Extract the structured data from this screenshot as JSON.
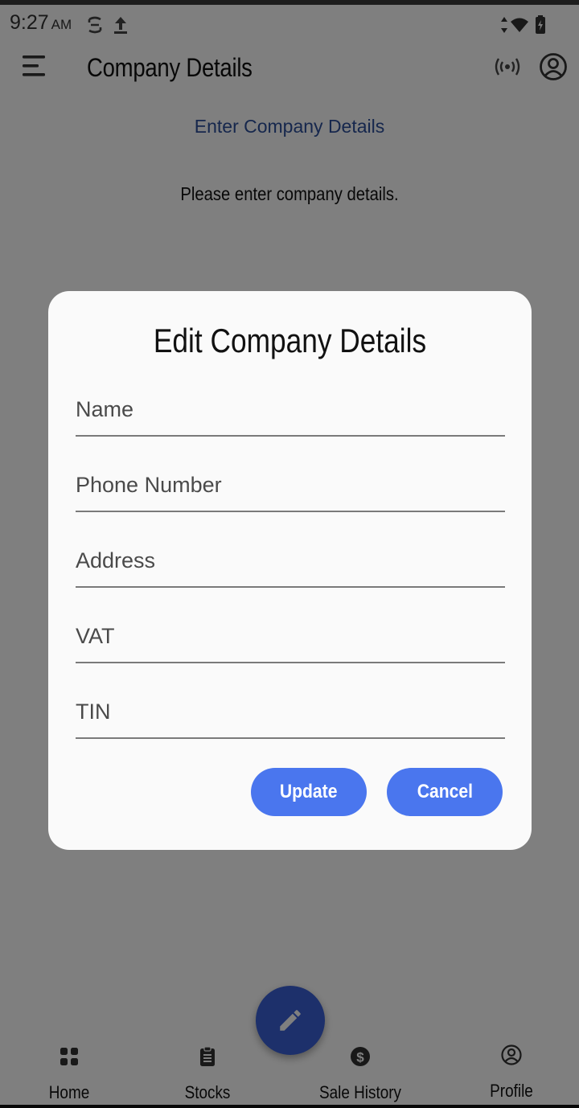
{
  "status_bar": {
    "time": "9:27",
    "ampm": "AM"
  },
  "app_bar": {
    "title": "Company Details",
    "icons": [
      "menu-icon",
      "radio-tower-icon",
      "account-circle-icon"
    ]
  },
  "page": {
    "heading": "Enter Company Details",
    "subtext": "Please enter company details."
  },
  "dialog": {
    "title": "Edit Company Details",
    "fields": [
      {
        "placeholder": "Name",
        "value": ""
      },
      {
        "placeholder": "Phone Number",
        "value": ""
      },
      {
        "placeholder": "Address",
        "value": ""
      },
      {
        "placeholder": "VAT",
        "value": ""
      },
      {
        "placeholder": "TIN",
        "value": ""
      }
    ],
    "update_label": "Update",
    "cancel_label": "Cancel"
  },
  "fab": {
    "icon": "pencil-icon"
  },
  "bottom_nav": {
    "items": [
      {
        "label": "Home",
        "icon": "grid-icon"
      },
      {
        "label": "Stocks",
        "icon": "clipboard-icon"
      },
      {
        "label": "Sale History",
        "icon": "dollar-icon"
      },
      {
        "label": "Profile",
        "icon": "account-circle-icon"
      }
    ]
  },
  "colors": {
    "accent": "#4a76ee",
    "fab": "#3b61d6",
    "heading": "#2c4f9a"
  }
}
